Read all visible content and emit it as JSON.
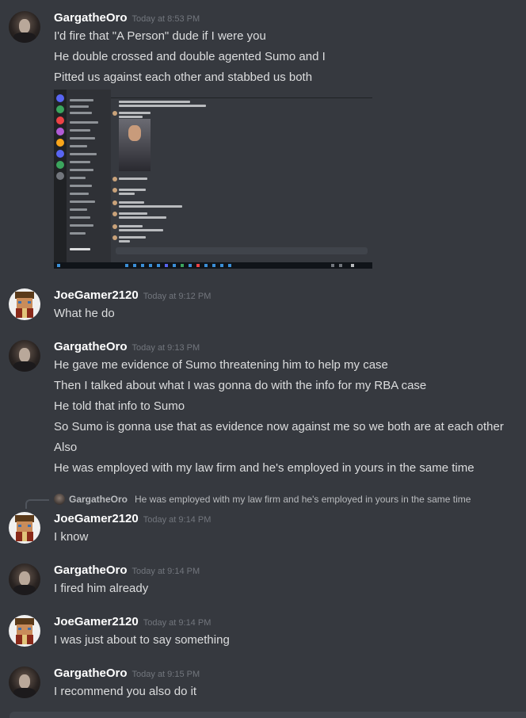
{
  "messages": [
    {
      "author": "GargatheOro",
      "timestamp": "Today at 8:53 PM",
      "avatar": "emperor-avatar",
      "lines": [
        "I'd fire that \"A Person\" dude if I were you",
        "He double crossed and double agented Sumo and I",
        "Pitted us against each other and stabbed us both"
      ]
    },
    {
      "author": "JoeGamer2120",
      "timestamp": "Today at 9:12 PM",
      "avatar": "minecraft-avatar",
      "lines": [
        "What he do"
      ]
    },
    {
      "author": "GargatheOro",
      "timestamp": "Today at 9:13 PM",
      "avatar": "emperor-avatar",
      "lines": [
        "He gave me evidence of Sumo threatening him to help my case",
        "Then I talked about what I was gonna do with the info for my RBA case",
        "He told that info to Sumo",
        "So Sumo is gonna use that as evidence now against me so we both are at each other",
        "Also",
        "He was employed with my law firm and he's employed in yours in the same time"
      ]
    },
    {
      "author": "JoeGamer2120",
      "timestamp": "Today at 9:14 PM",
      "avatar": "minecraft-avatar",
      "reply": {
        "author": "GargatheOro",
        "text": "He was employed with my law firm and he's employed in yours in the same time"
      },
      "lines": [
        "I know"
      ]
    },
    {
      "author": "GargatheOro",
      "timestamp": "Today at 9:14 PM",
      "avatar": "emperor-avatar",
      "lines": [
        "I fired him already"
      ]
    },
    {
      "author": "JoeGamer2120",
      "timestamp": "Today at 9:14 PM",
      "avatar": "minecraft-avatar",
      "lines": [
        "I was just about to say something"
      ]
    },
    {
      "author": "GargatheOro",
      "timestamp": "Today at 9:15 PM",
      "avatar": "emperor-avatar",
      "lines": [
        "I recommend you also do it"
      ]
    }
  ],
  "attachment": {
    "kind": "discord-screenshot",
    "header_title": "A person"
  },
  "colors": {
    "background": "#36393f",
    "text": "#dcddde",
    "author": "#ffffff",
    "timestamp": "#72767d"
  }
}
